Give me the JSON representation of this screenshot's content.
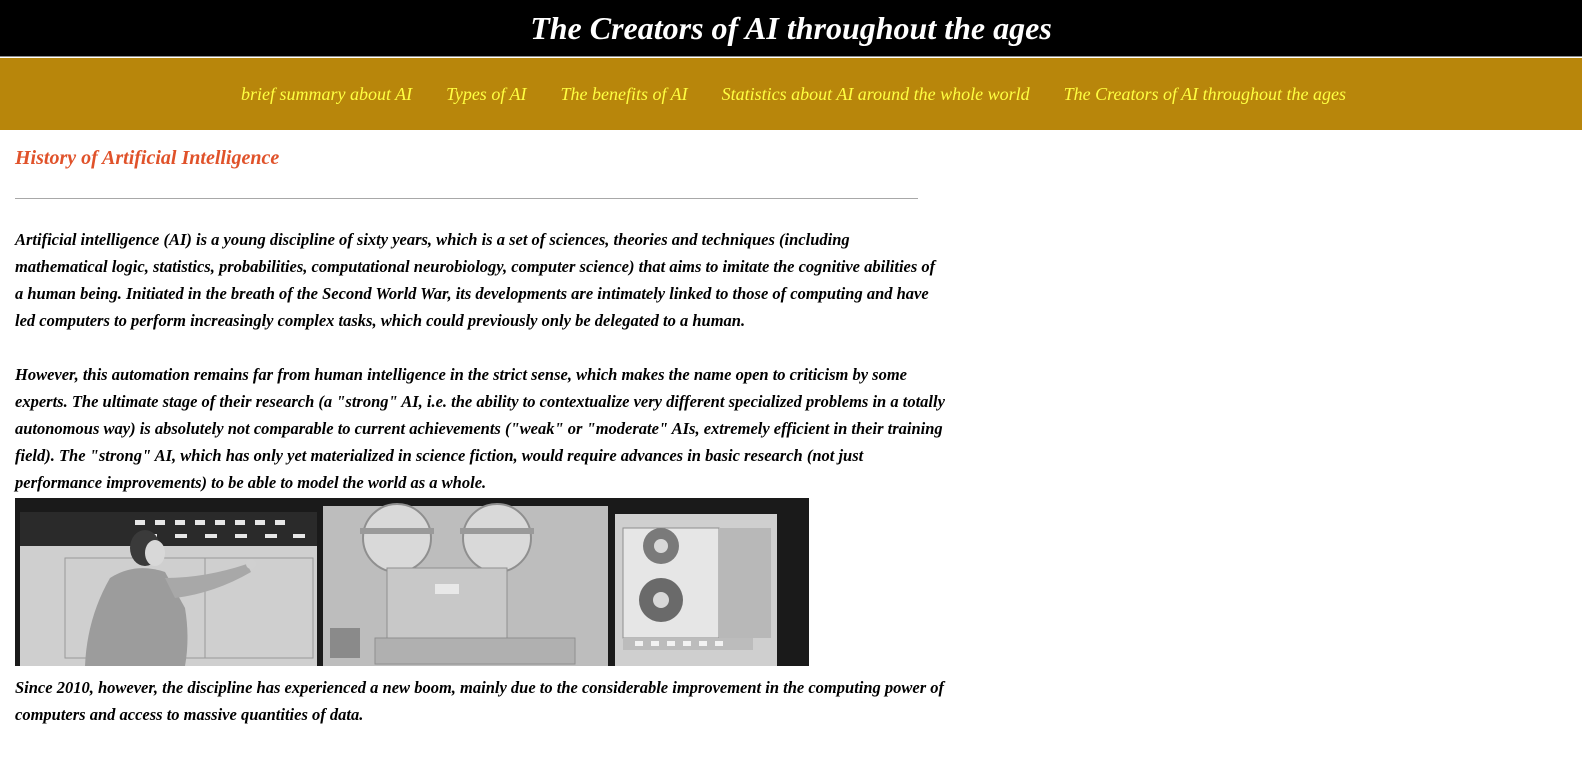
{
  "header": {
    "title": "The Creators of AI throughout the ages"
  },
  "nav": {
    "items": [
      {
        "label": "brief summary about AI"
      },
      {
        "label": "Types of AI"
      },
      {
        "label": "The benefits of AI"
      },
      {
        "label": "Statistics about AI around the whole world"
      },
      {
        "label": "The Creators of AI throughout the ages"
      }
    ]
  },
  "main": {
    "heading": "History of Artificial Intelligence",
    "paragraphs": [
      "Artificial intelligence (AI) is a young discipline of sixty years, which is a set of sciences, theories and techniques (including mathematical logic, statistics, probabilities, computational neurobiology, computer science) that aims to imitate the cognitive abilities of a human being. Initiated in the breath of the Second World War, its developments are intimately linked to those of computing and have led computers to perform increasingly complex tasks, which could previously only be delegated to a human.",
      "However, this automation remains far from human intelligence in the strict sense, which makes the name open to criticism by some experts. The ultimate stage of their research (a \"strong\" AI, i.e. the ability to contextualize very different specialized problems in a totally autonomous way) is absolutely not comparable to current achievements (\"weak\" or \"moderate\" AIs, extremely efficient in their training field). The \"strong\" AI, which has only yet materialized in science fiction, would require advances in basic research (not just performance improvements) to be able to model the world as a whole.",
      "Since 2010, however, the discipline has experienced a new boom, mainly due to the considerable improvement in the computing power of computers and access to massive quantities of data."
    ]
  },
  "colors": {
    "header_bg": "#000000",
    "nav_bg": "#b8860b",
    "nav_link": "#ffff40",
    "heading": "#e0522a"
  }
}
